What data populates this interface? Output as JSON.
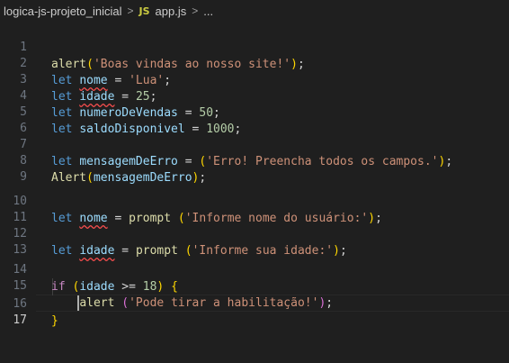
{
  "breadcrumb": {
    "folder": "logica-js-projeto_inicial",
    "separator": ">",
    "file_icon": "JS",
    "file": "app.js",
    "more": "..."
  },
  "editor": {
    "active_line": 17,
    "lines": [
      {
        "n": "1"
      },
      {
        "n": "2"
      },
      {
        "n": "3"
      },
      {
        "n": "4"
      },
      {
        "n": "5"
      },
      {
        "n": "6"
      },
      {
        "n": "7"
      },
      {
        "n": "8"
      },
      {
        "n": "9"
      },
      {
        "n": "10"
      },
      {
        "n": "11"
      },
      {
        "n": "12"
      },
      {
        "n": "13"
      },
      {
        "n": "14"
      },
      {
        "n": "15"
      },
      {
        "n": "16"
      },
      {
        "n": "17"
      }
    ],
    "tokens": {
      "l1": [
        "alert",
        "(",
        "'Boas vindas ao nosso site!'",
        ")",
        ";"
      ],
      "l2": [
        "let",
        "nome",
        "=",
        "'Lua'",
        ";"
      ],
      "l3": [
        "let",
        "idade",
        "=",
        "25",
        ";"
      ],
      "l4": [
        "let",
        "numeroDeVendas",
        "=",
        "50",
        ";"
      ],
      "l5": [
        "let",
        "saldoDisponivel",
        "=",
        "1000",
        ";"
      ],
      "l7": [
        "let",
        "mensagemDeErro",
        "=",
        "(",
        "'Erro! Preencha todos os campos.'",
        ")",
        ";"
      ],
      "l8": [
        "Alert",
        "(",
        "mensagemDeErro",
        ")",
        ";"
      ],
      "l10": [
        "let",
        "nome",
        "=",
        "prompt",
        "(",
        "'Informe nome do usuário:'",
        ")",
        ";"
      ],
      "l12": [
        "let",
        "idade",
        "=",
        "prompt",
        "(",
        "'Informe sua idade:'",
        ")",
        ";"
      ],
      "l14": [
        "if",
        "(",
        "idade",
        ">=",
        "18",
        ")",
        "{"
      ],
      "l15": [
        "alert",
        "(",
        "'Pode tirar a habilitação!'",
        ")",
        ";"
      ],
      "l16": [
        "}"
      ]
    }
  }
}
